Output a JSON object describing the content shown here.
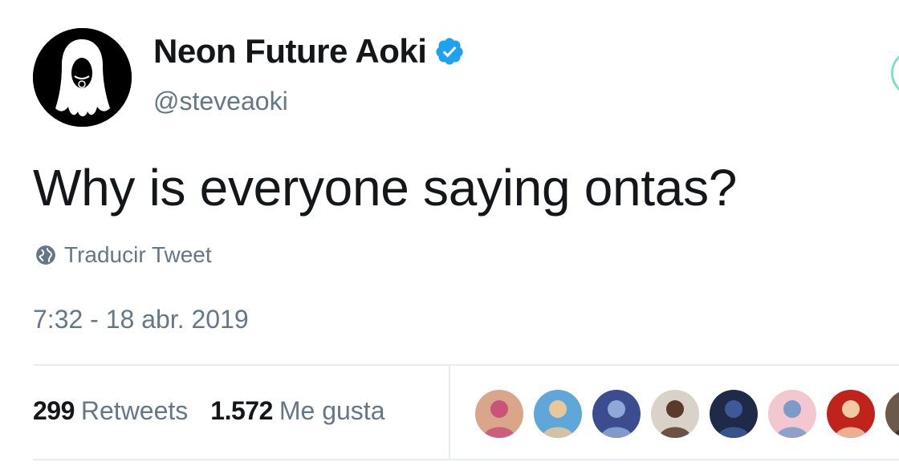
{
  "user": {
    "display_name": "Neon Future Aoki",
    "handle": "@steveaoki",
    "verified": true,
    "avatar_icon": "silhouette-long-hair-icon"
  },
  "tweet": {
    "text": "Why is everyone saying ontas?",
    "translate_label": "Traducir Tweet",
    "timestamp": "7:32 - 18 abr. 2019"
  },
  "stats": {
    "retweets_count": "299",
    "retweets_label": "Retweets",
    "likes_count": "1.572",
    "likes_label": "Me gusta"
  },
  "colors": {
    "verified_blue": "#1da1f2",
    "secondary_text": "#657786",
    "divider": "#e6ecf0",
    "follow_button_edge": "#7fe0c6"
  },
  "likers": [
    {
      "id": "liker-1",
      "color": "#d9a68a",
      "accent": "#c8547a"
    },
    {
      "id": "liker-2",
      "color": "#5fa7d9",
      "accent": "#e9c79a"
    },
    {
      "id": "liker-3",
      "color": "#3b4d8f",
      "accent": "#8fa8d6"
    },
    {
      "id": "liker-4",
      "color": "#d8d2c8",
      "accent": "#5a3b2a"
    },
    {
      "id": "liker-5",
      "color": "#1f2a48",
      "accent": "#3c5a9a"
    },
    {
      "id": "liker-6",
      "color": "#f2c7cf",
      "accent": "#7d9bc8"
    },
    {
      "id": "liker-7",
      "color": "#c0231b",
      "accent": "#f1c9a5"
    },
    {
      "id": "liker-8",
      "color": "#6b5a4b",
      "accent": "#3a2e26"
    }
  ]
}
